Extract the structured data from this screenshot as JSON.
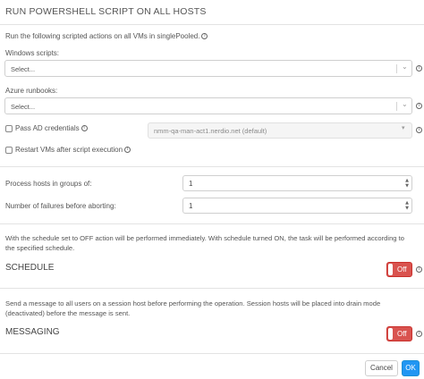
{
  "dialog": {
    "title": "RUN POWERSHELL SCRIPT ON ALL HOSTS"
  },
  "intro": {
    "text": "Run the following scripted actions on all VMs in singlePooled."
  },
  "windows_scripts": {
    "label": "Windows scripts:",
    "value": "Select..."
  },
  "azure_runbooks": {
    "label": "Azure runbooks:",
    "value": "Select..."
  },
  "pass_ad": {
    "label": "Pass AD credentials",
    "checked": false,
    "dropdown_value": "nmm-qa-man-act1.nerdio.net (default)"
  },
  "restart_vms": {
    "label": "Restart VMs after script execution",
    "checked": false
  },
  "process_groups": {
    "label": "Process hosts in groups of:",
    "value": "1"
  },
  "failures": {
    "label": "Number of failures before aborting:",
    "value": "1"
  },
  "schedule": {
    "note_line1": "With the schedule set to OFF action will be performed immediately. With schedule turned ON, the task will be performed according to",
    "note_line2": "the specified schedule.",
    "title": "SCHEDULE",
    "toggle_label": "Off"
  },
  "messaging": {
    "note_line1": "Send a message to all users on a session host before performing the operation. Session hosts will be placed into drain mode",
    "note_line2": "(deactivated) before the message is sent.",
    "title": "MESSAGING",
    "toggle_label": "Off"
  },
  "footer": {
    "cancel_label": "Cancel",
    "ok_label": "OK"
  },
  "icons": {
    "info": "info-icon",
    "chevron": "chevron-down-icon",
    "spinner": "spin-arrows-icon"
  },
  "colors": {
    "toggle_off": "#d9534f",
    "primary": "#2196f3"
  }
}
